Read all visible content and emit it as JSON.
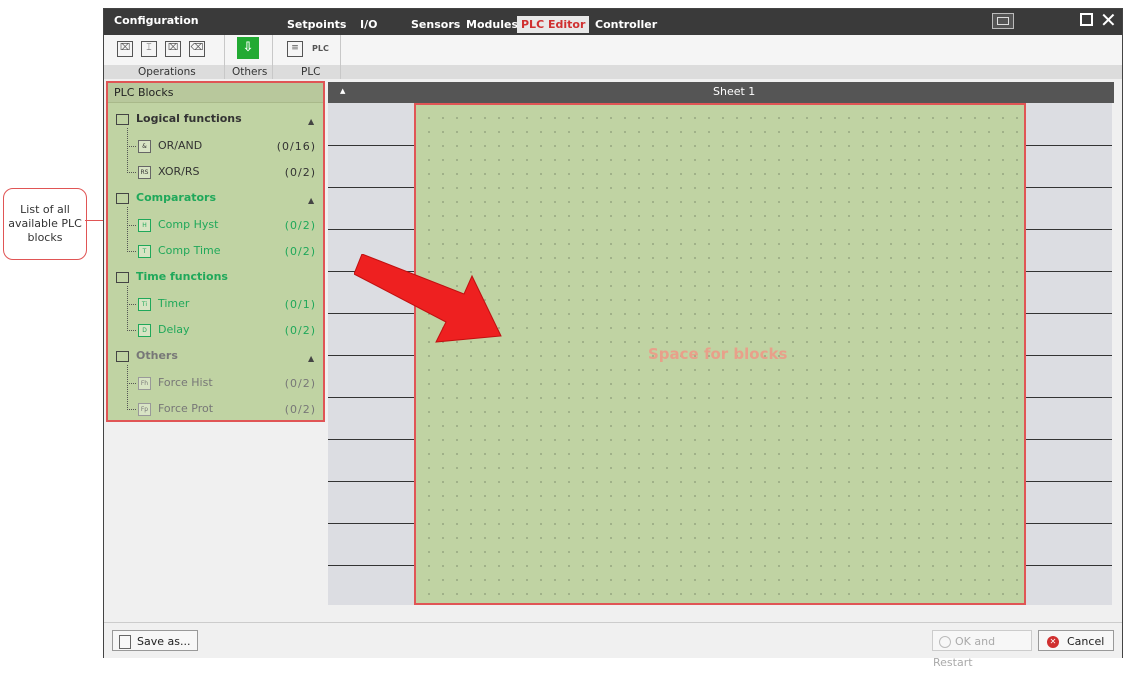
{
  "callout": {
    "text": "List of all available PLC blocks"
  },
  "window": {
    "title": "Configuration",
    "tabs": [
      "Setpoints",
      "I/O",
      "Sensors",
      "Modules",
      "PLC Editor",
      "Controller"
    ],
    "active_tab": "PLC Editor"
  },
  "toolbar": {
    "groups": [
      "Operations",
      "Others",
      "PLC"
    ],
    "plc_icon_text": "PLC"
  },
  "panel": {
    "title": "PLC Blocks",
    "groups": [
      {
        "name": "Logical functions",
        "color": "#333333",
        "items": [
          {
            "icon": "&",
            "label": "OR/AND",
            "count": "(0/16)"
          },
          {
            "icon": "RS",
            "label": "XOR/RS",
            "count": "(0/2)"
          }
        ]
      },
      {
        "name": "Comparators",
        "color": "#1fa85a",
        "items": [
          {
            "icon": "H",
            "label": "Comp Hyst",
            "count": "(0/2)"
          },
          {
            "icon": "T",
            "label": "Comp Time",
            "count": "(0/2)"
          }
        ]
      },
      {
        "name": "Time functions",
        "color": "#1fa85a",
        "items": [
          {
            "icon": "Ti",
            "label": "Timer",
            "count": "(0/1)"
          },
          {
            "icon": "D",
            "label": "Delay",
            "count": "(0/2)"
          }
        ]
      },
      {
        "name": "Others",
        "color": "#777777",
        "items": [
          {
            "icon": "Fh",
            "label": "Force Hist",
            "count": "(0/2)"
          },
          {
            "icon": "Fp",
            "label": "Force Prot",
            "count": "(0/2)"
          }
        ]
      }
    ]
  },
  "sheet": {
    "title": "Sheet 1",
    "space_label": "Space for blocks"
  },
  "bottom": {
    "save_label": "Save as...",
    "ok_label": "OK and Restart",
    "cancel_label": "Cancel"
  },
  "colors": {
    "accent_red": "#e05555",
    "active_tab": "#d03030",
    "green": "#22aa33",
    "panel_bg": "#c0d3a3"
  }
}
